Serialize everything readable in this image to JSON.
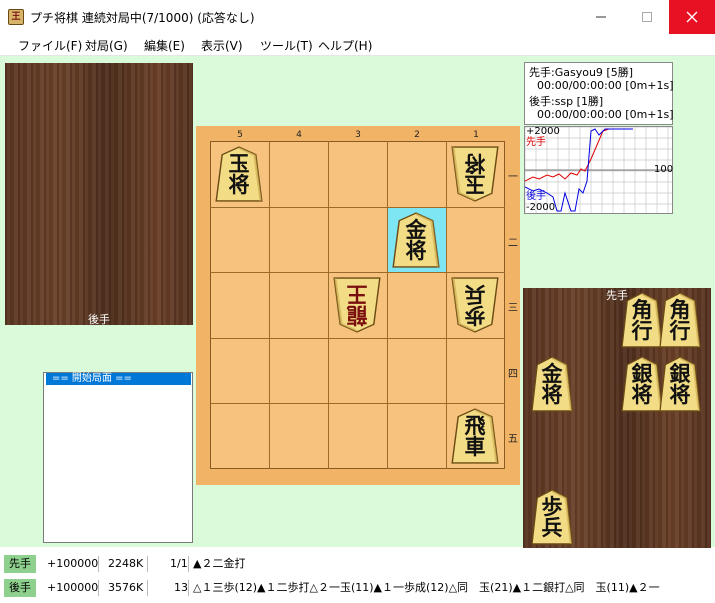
{
  "window": {
    "title": "プチ将棋 連続対局中(7/1000) (応答なし)",
    "app_icon_text": "王",
    "min_icon": "minimize-icon",
    "max_icon": "maximize-icon",
    "close_icon": "close-icon"
  },
  "menu": [
    "ファイル(F)",
    "対局(G)",
    "編集(E)",
    "表示(V)",
    "ツール(T)",
    "ヘルプ(H)"
  ],
  "board": {
    "file_labels": [
      "5",
      "4",
      "3",
      "2",
      "1"
    ],
    "rank_labels": [
      "一",
      "二",
      "三",
      "四",
      "五"
    ],
    "last_move_square": "2二",
    "pieces": [
      {
        "square": "5一",
        "text": "玉将",
        "owner": "sente",
        "promoted": false
      },
      {
        "square": "1一",
        "text": "玉将",
        "owner": "gote",
        "promoted": false
      },
      {
        "square": "2二",
        "text": "金将",
        "owner": "sente",
        "promoted": false
      },
      {
        "square": "3三",
        "text": "龍王",
        "owner": "gote",
        "promoted": true
      },
      {
        "square": "1三",
        "text": "歩兵",
        "owner": "gote",
        "promoted": false
      },
      {
        "square": "1五",
        "text": "飛車",
        "owner": "sente",
        "promoted": false
      }
    ]
  },
  "gote_stand": {
    "label": "後手",
    "pieces": []
  },
  "sente_stand": {
    "label": "先手",
    "pieces": [
      {
        "text": "角行",
        "promoted": false
      },
      {
        "text": "角行",
        "promoted": false
      },
      {
        "text": "金将",
        "promoted": false
      },
      {
        "text": "銀将",
        "promoted": false
      },
      {
        "text": "銀将",
        "promoted": false
      },
      {
        "text": "歩兵",
        "promoted": false
      }
    ]
  },
  "movelist": {
    "items": [
      "==  開始局面  =="
    ]
  },
  "clock": {
    "sente_line1": "先手:Gasyou9 [5勝]",
    "sente_line2": "00:00/00:00:00 [0m+1s]",
    "gote_line1": "後手:ssp [1勝]",
    "gote_line2": "00:00/00:00:00 [0m+1s]"
  },
  "graph": {
    "top_label": "+2000",
    "bottom_label": "-2000",
    "x_label": "100",
    "sente_label": "先手",
    "gote_label": "後手",
    "colors": {
      "sente": "#e00000",
      "gote": "#0000e0",
      "grid": "#c8c8c8"
    }
  },
  "status": {
    "sente": {
      "tag": "先手",
      "nodes": "+100000",
      "mem": "2248K",
      "move_no": "1/1",
      "pv": "▲２二金打"
    },
    "gote": {
      "tag": "後手",
      "nodes": "+100000",
      "mem": "3576K",
      "move_no": "13",
      "pv": "△１三歩(12)▲１二歩打△２一玉(11)▲１一歩成(12)△同　玉(21)▲１二銀打△同　玉(11)▲２一"
    }
  }
}
